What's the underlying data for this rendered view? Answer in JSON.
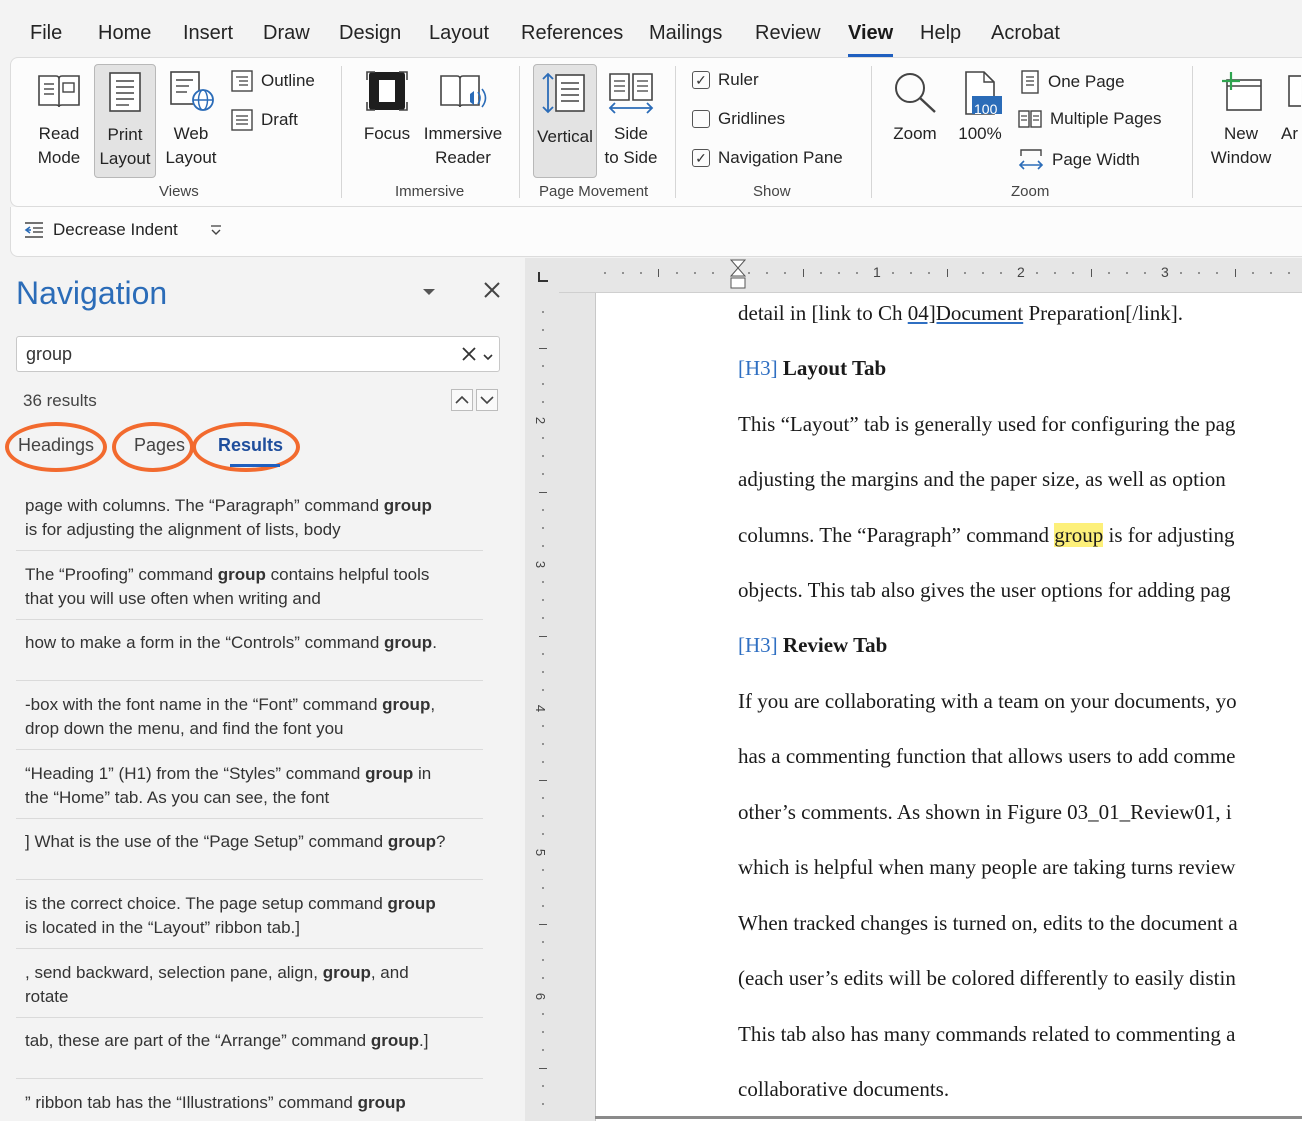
{
  "menu": {
    "tabs": [
      "File",
      "Home",
      "Insert",
      "Draw",
      "Design",
      "Layout",
      "References",
      "Mailings",
      "Review",
      "View",
      "Help",
      "Acrobat"
    ],
    "active": "View"
  },
  "ribbon": {
    "views": {
      "label": "Views",
      "read_mode": [
        "Read",
        "Mode"
      ],
      "print_layout": [
        "Print",
        "Layout"
      ],
      "web_layout": [
        "Web",
        "Layout"
      ],
      "outline": "Outline",
      "draft": "Draft"
    },
    "immersive": {
      "label": "Immersive",
      "focus": "Focus",
      "immersive_reader": [
        "Immersive",
        "Reader"
      ]
    },
    "page_movement": {
      "label": "Page Movement",
      "vertical": "Vertical",
      "side_to_side": [
        "Side",
        "to Side"
      ]
    },
    "show": {
      "label": "Show",
      "ruler": "Ruler",
      "gridlines": "Gridlines",
      "navigation_pane": "Navigation Pane"
    },
    "zoom": {
      "label": "Zoom",
      "zoom": "Zoom",
      "zoom100": "100%",
      "icon_value": "100",
      "one_page": "One Page",
      "multiple_pages": "Multiple Pages",
      "page_width": "Page Width"
    },
    "window": {
      "new_window": [
        "New",
        "Window"
      ],
      "arrange": "Ar"
    }
  },
  "qat": {
    "decrease_indent": "Decrease Indent"
  },
  "navigation": {
    "title": "Navigation",
    "search_value": "group",
    "results_count": "36 results",
    "tabs": [
      "Headings",
      "Pages",
      "Results"
    ],
    "results": [
      {
        "pre1": "page with columns. The “Paragraph” command ",
        "bold1": "group",
        "post1": "",
        "line2": "is for adjusting the alignment of lists, body"
      },
      {
        "pre1": "The “Proofing” command ",
        "bold1": "group",
        "post1": " contains helpful tools",
        "line2": "that you will use often when writing and"
      },
      {
        "pre1": "how to make a form in the “Controls” command ",
        "bold1": "group",
        "post1": ".",
        "line2": ""
      },
      {
        "pre1": "-box with the font name in the “Font” command ",
        "bold1": "group",
        "post1": ",",
        "line2": "drop down the menu, and find the font you"
      },
      {
        "pre1": "“Heading 1” (H1) from the “Styles” command ",
        "bold1": "group",
        "post1": " in",
        "line2": "the “Home” tab. As you can see, the font"
      },
      {
        "pre1": "] What is the use of the “Page Setup” command ",
        "bold1": "group",
        "post1": "?",
        "line2": ""
      },
      {
        "pre1": "is the correct choice. The page setup command ",
        "bold1": "group",
        "post1": "",
        "line2": "is located in the “Layout” ribbon tab.]"
      },
      {
        "pre1": ", send backward, selection pane, align, ",
        "bold1": "group",
        "post1": ", and",
        "line2": "rotate"
      },
      {
        "pre1": "tab, these are part of the “Arrange” command ",
        "bold1": "group",
        "post1": ".]",
        "line2": ""
      },
      {
        "pre1": "” ribbon tab has the “Illustrations” command ",
        "bold1": "group",
        "post1": "",
        "line2": ""
      }
    ]
  },
  "ruler": {
    "numbers": [
      "1",
      "2",
      "3"
    ],
    "vnumbers": [
      "2",
      "3",
      "4",
      "5",
      "6"
    ]
  },
  "document": {
    "l1_a": "detail in [link to Ch ",
    "l1_b": "04]Document",
    "l1_c": " Preparation[/link].",
    "h1_tag": "[H3]",
    "h1_text": " Layout Tab",
    "p1": "This “Layout” tab is generally used for configuring the pag",
    "p2": "adjusting the margins and the paper size, as well as option",
    "p3_a": "columns. The “Paragraph” command ",
    "p3_hl": "group",
    "p3_b": " is for adjusting",
    "p4": "objects. This tab also gives the user options for adding pag",
    "h2_tag": "[H3]",
    "h2_text": " Review Tab",
    "p5": "If you are collaborating with a team on your documents, yo",
    "p6": "has a commenting function that allows users to add comme",
    "p7": "other’s comments. As shown in Figure 03_01_Review01, i",
    "p8": "which is helpful when many people are taking turns review",
    "p9": "When tracked changes is turned on, edits to the document a",
    "p10": "(each user’s edits will be colored differently to easily distin",
    "p11": "This tab also has many commands related to commenting a",
    "p12": "collaborative documents."
  },
  "colors": {
    "accent": "#2b6cb8",
    "annotation": "#f26a2e",
    "highlight": "#fdf07a"
  }
}
